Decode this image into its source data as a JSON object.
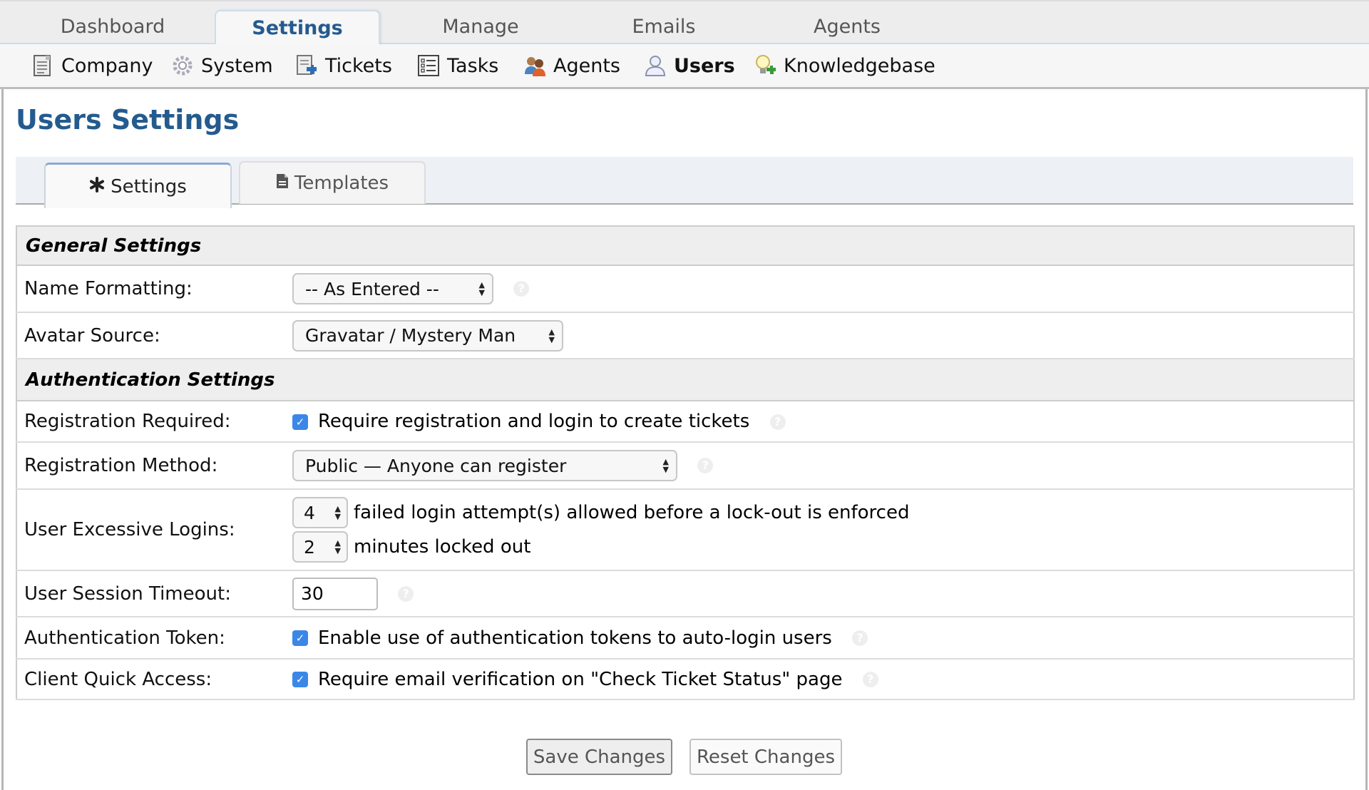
{
  "top_tabs": [
    {
      "label": "Dashboard",
      "active": false
    },
    {
      "label": "Settings",
      "active": true
    },
    {
      "label": "Manage",
      "active": false
    },
    {
      "label": "Emails",
      "active": false
    },
    {
      "label": "Agents",
      "active": false
    }
  ],
  "sub_nav": [
    {
      "label": "Company",
      "icon": "document-icon"
    },
    {
      "label": "System",
      "icon": "gear-icon"
    },
    {
      "label": "Tickets",
      "icon": "ticket-puzzle-icon"
    },
    {
      "label": "Tasks",
      "icon": "checklist-icon"
    },
    {
      "label": "Agents",
      "icon": "agents-icon"
    },
    {
      "label": "Users",
      "icon": "user-icon",
      "active": true
    },
    {
      "label": "Knowledgebase",
      "icon": "lightbulb-icon"
    }
  ],
  "page_title": "Users Settings",
  "tabs": [
    {
      "label": "Settings",
      "icon": "asterisk-icon",
      "active": true
    },
    {
      "label": "Templates",
      "icon": "file-icon",
      "active": false
    }
  ],
  "sections": {
    "general": "General Settings",
    "authentication": "Authentication Settings"
  },
  "fields": {
    "name_formatting": {
      "label": "Name Formatting:",
      "value": "-- As Entered --"
    },
    "avatar_source": {
      "label": "Avatar Source:",
      "value": "Gravatar / Mystery Man"
    },
    "registration_required": {
      "label": "Registration Required:",
      "checked": true,
      "text": "Require registration and login to create tickets"
    },
    "registration_method": {
      "label": "Registration Method:",
      "value": "Public — Anyone can register"
    },
    "excessive_logins": {
      "label": "User Excessive Logins:",
      "attempts": "4",
      "attempts_text": "failed login attempt(s) allowed before a lock-out is enforced",
      "minutes": "2",
      "minutes_text": "minutes locked out"
    },
    "session_timeout": {
      "label": "User Session Timeout:",
      "value": "30"
    },
    "auth_token": {
      "label": "Authentication Token:",
      "checked": true,
      "text": "Enable use of authentication tokens to auto-login users"
    },
    "client_quick_access": {
      "label": "Client Quick Access:",
      "checked": true,
      "text": "Require email verification on \"Check Ticket Status\" page"
    }
  },
  "help_glyph": "?",
  "check_glyph": "✓",
  "buttons": {
    "save": "Save Changes",
    "reset": "Reset Changes"
  },
  "colors": {
    "accent": "#245b8f",
    "checkbox": "#3b87e8"
  }
}
